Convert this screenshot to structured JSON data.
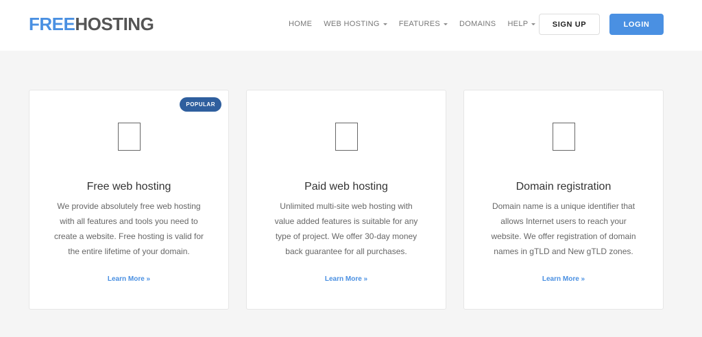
{
  "header": {
    "logo": {
      "part1": "FREE",
      "part2": "HOSTING"
    },
    "nav": [
      {
        "label": "HOME",
        "dropdown": false
      },
      {
        "label": "WEB HOSTING",
        "dropdown": true
      },
      {
        "label": "FEATURES",
        "dropdown": true
      },
      {
        "label": "DOMAINS",
        "dropdown": false
      },
      {
        "label": "HELP",
        "dropdown": true
      }
    ],
    "signup_label": "SIGN UP",
    "login_label": "LOGIN"
  },
  "cards": [
    {
      "badge": "POPULAR",
      "icon": "blank-square-icon",
      "title": "Free web hosting",
      "description": "We provide absolutely free web hosting with all features and tools you need to create a website. Free hosting is valid for the entire lifetime of your domain.",
      "link": "Learn More »"
    },
    {
      "icon": "blank-square-icon",
      "title": "Paid web hosting",
      "description": "Unlimited multi-site web hosting with value added features is suitable for any type of project. We offer 30-day money back guarantee for all purchases.",
      "link": "Learn More »"
    },
    {
      "icon": "blank-square-icon",
      "title": "Domain registration",
      "description": "Domain name is a unique identifier that allows Internet users to reach your website. We offer registration of domain names in gTLD and New gTLD zones.",
      "link": "Learn More »"
    }
  ],
  "colors": {
    "accent": "#4a90e2",
    "badge": "#2f5f9e",
    "background": "#f5f5f5"
  }
}
